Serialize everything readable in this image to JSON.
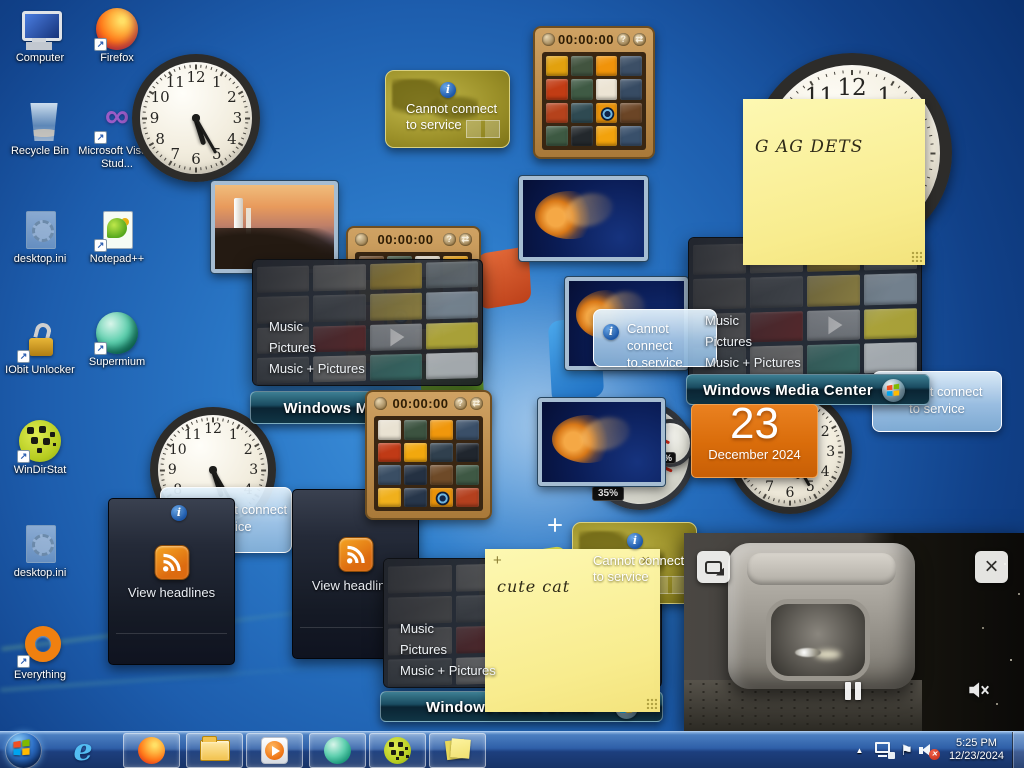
{
  "desktop_icons": [
    {
      "name": "computer",
      "label": "Computer"
    },
    {
      "name": "firefox",
      "label": "Firefox"
    },
    {
      "name": "recycle-bin",
      "label": "Recycle Bin"
    },
    {
      "name": "microsoft-visual-studio",
      "label": "Microsoft Visual Stud..."
    },
    {
      "name": "desktop-ini",
      "label": "desktop.ini"
    },
    {
      "name": "notepad-plus-plus",
      "label": "Notepad++"
    },
    {
      "name": "iobit-unlocker",
      "label": "IObit Unlocker"
    },
    {
      "name": "supermium",
      "label": "Supermium"
    },
    {
      "name": "windirstat",
      "label": "WinDirStat"
    },
    {
      "name": "desktop-ini-2",
      "label": "desktop.ini"
    },
    {
      "name": "everything",
      "label": "Everything"
    }
  ],
  "gadgets": {
    "clock": {
      "numerals": [
        "12",
        "1",
        "2",
        "3",
        "4",
        "5",
        "6",
        "7",
        "8",
        "9",
        "10",
        "11"
      ],
      "hour_angle": 162.5,
      "minute_angle": 150
    },
    "weather_error": {
      "line1": "Cannot connect",
      "line2": "to service"
    },
    "puzzle": {
      "timer": "00:00:00",
      "help": "?",
      "shuffle": "⇄",
      "tiles_top": [
        "#e2a10e",
        "#42543f",
        "#f0930a",
        "#3c4f66",
        "#c23c14",
        "#3f5a44",
        "#ece4d4",
        "#374b63",
        "#b5421c",
        "#2f4a52",
        "eye",
        "#6b4526",
        "#3d5942",
        "#23282c",
        "#f2a20c",
        "#39506b"
      ],
      "tiles_mid_upper": [
        "#6e4a28",
        "#3e5542",
        "#ece4d2",
        "#f2a50e",
        "#e0940e",
        "#c23c14",
        "#3f5a44",
        "#374b63",
        "#b5421c",
        "eye",
        "#6b4526",
        "#2f4a52",
        "#3d5942",
        "#23282c",
        "#f2a20c",
        "#39506b"
      ],
      "tiles_mid": [
        "#e9e2d2",
        "#3c5340",
        "#f0970c",
        "#3a4f68",
        "#c03a16",
        "#f2a80e",
        "#30404e",
        "#20262e",
        "#3a4e64",
        "#243142",
        "#6e4a28",
        "#3e5844",
        "#f0b01c",
        "#27364a",
        "eye",
        "#b4401e"
      ]
    },
    "media_center": {
      "menu": [
        "Music",
        "Pictures",
        "Music + Pictures"
      ],
      "bar_title": "Windows Media Center",
      "mosaic": [
        "#8e8a84",
        "#97948e",
        "#c9a93a",
        "#6f7a80",
        "#7d7a74",
        "#5b5f63",
        "#b7a34a",
        "#8fa0ae",
        "#8a8782",
        "#7a2c2c",
        "play",
        "#d8cc3e",
        "#5f6568",
        "#93918d",
        "#3f7a72",
        "#cfd6da"
      ]
    },
    "sticky_notes": {
      "note1": "G AG DETS",
      "note2": "cute cat",
      "add": "+",
      "close": "×"
    },
    "rss": {
      "label": "View headlines"
    },
    "calendar": {
      "day": "23",
      "month": "December 2024"
    },
    "cpu_meter": {
      "small_value": "2%",
      "large_value": "35%"
    }
  },
  "video_overlay": {
    "close": "×"
  },
  "taskbar": {
    "apps": [
      "start",
      "internet-explorer",
      "firefox",
      "windows-explorer",
      "windows-media-player",
      "supermium",
      "windirstat",
      "sticky-notes"
    ],
    "tray": {
      "time": "5:25 PM",
      "date": "12/23/2024"
    }
  },
  "colors": {
    "flag": [
      "#f25022",
      "#7fba00",
      "#00a4ef",
      "#ffb900"
    ],
    "calendar_orange": "#d96c0a",
    "note_yellow": "#f8ec8e",
    "taskbar_blue": "#2f5fa8"
  }
}
